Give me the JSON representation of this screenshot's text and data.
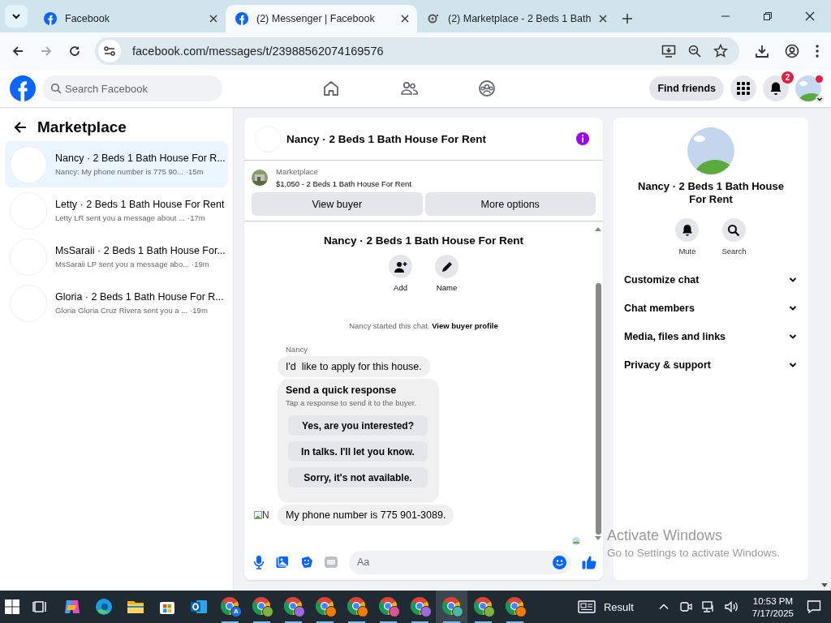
{
  "browser": {
    "tabs": [
      {
        "title": "Facebook",
        "selected": false,
        "kind": "facebook"
      },
      {
        "title": "(2) Messenger | Facebook",
        "selected": true,
        "kind": "facebook"
      },
      {
        "title": "(2) Marketplace - 2 Beds 1 Bath",
        "selected": false,
        "kind": "loading"
      }
    ],
    "url": "facebook.com/messages/t/23988562074169576"
  },
  "header": {
    "search": {
      "placeholder": "Search Facebook"
    },
    "find_friends": "Find friends",
    "notification_count": "2"
  },
  "sidebar": {
    "title": "Marketplace",
    "conversations": [
      {
        "title": "Nancy · 2 Beds 1 Bath House For R...",
        "preview": "Nancy: My phone number is 775 90...",
        "time": "·15m",
        "selected": true
      },
      {
        "title": "Letty · 2 Beds 1 Bath House For Rent",
        "preview": "Letty LR sent you a message about ...",
        "time": "·17m",
        "selected": false
      },
      {
        "title": "MsSaraii · 2 Beds 1 Bath House For...",
        "preview": "MsSaraii LP sent you a message abo...",
        "time": "·19m",
        "selected": false
      },
      {
        "title": "Gloria · 2 Beds 1 Bath House For R...",
        "preview": "Gloria Gloria Cruz Rivera sent you a ...",
        "time": "·19m",
        "selected": false
      }
    ]
  },
  "chat": {
    "title": "Nancy · 2 Beds 1 Bath House For Rent",
    "listing": {
      "label": "Marketplace",
      "text": "$1,050 - 2 Beds 1 Bath House For Rent"
    },
    "buttons": [
      "View buyer",
      "More options"
    ],
    "intro": {
      "title": "Nancy · 2 Beds 1 Bath House For Rent",
      "actions": [
        {
          "label": "Add",
          "kind": "add-person"
        },
        {
          "label": "Name",
          "kind": "pencil"
        }
      ],
      "notice": "Nancy started this chat.",
      "notice_link": "View buyer profile"
    },
    "sender": "Nancy",
    "messages": [
      {
        "kind": "text",
        "text": "I'd  like to apply for this house."
      },
      {
        "kind": "quick_response",
        "title": "Send a quick response",
        "hint": "Tap a response to send it to the buyer.",
        "options": [
          "Yes, are you interested?",
          "In talks. I'll let you know.",
          "Sorry, it's not available."
        ]
      },
      {
        "kind": "text",
        "text": "My phone number is 775 901-3089.",
        "avatar_alt": "N"
      }
    ],
    "composer": {
      "placeholder": "Aa"
    }
  },
  "details": {
    "name": "Nancy · 2 Beds 1 Bath House For Rent",
    "actions": [
      {
        "label": "Mute",
        "kind": "bell"
      },
      {
        "label": "Search",
        "kind": "search"
      }
    ],
    "sections": [
      {
        "label": "Customize chat",
        "expanded": false
      },
      {
        "label": "Chat members",
        "expanded": false
      },
      {
        "label": "Media, files and links",
        "expanded": false
      },
      {
        "label": "Privacy & support",
        "expanded": false
      }
    ]
  },
  "os_notice": {
    "title": "Activate Windows",
    "text": "Go to Settings to activate Windows."
  },
  "taskbar": {
    "apps": [
      {
        "kind": "taskview"
      },
      {
        "kind": "copilot"
      },
      {
        "kind": "edge"
      },
      {
        "kind": "explorer"
      },
      {
        "kind": "store"
      },
      {
        "kind": "outlook"
      },
      {
        "kind": "chrome",
        "color": "#1a73e8",
        "badge": "A",
        "selected": false
      },
      {
        "kind": "chrome",
        "color": "#7cb342",
        "selected": false
      },
      {
        "kind": "chrome",
        "color": "#9c6ade",
        "selected": false
      },
      {
        "kind": "chrome",
        "color": "#f57c00",
        "selected": false
      },
      {
        "kind": "chrome",
        "color": "#f57c00",
        "selected": false
      },
      {
        "kind": "chrome",
        "color": "#e05297",
        "selected": false
      },
      {
        "kind": "chrome",
        "color": "#9c6ade",
        "selected": false
      },
      {
        "kind": "chrome",
        "color": "#4db6ac",
        "selected": true
      },
      {
        "kind": "chrome",
        "color": "#7cb342",
        "selected": false
      },
      {
        "kind": "chrome",
        "color": "#f57c00",
        "selected": false
      }
    ],
    "widget": "Result",
    "time": "10:53 PM",
    "date": "7/17/2025"
  }
}
